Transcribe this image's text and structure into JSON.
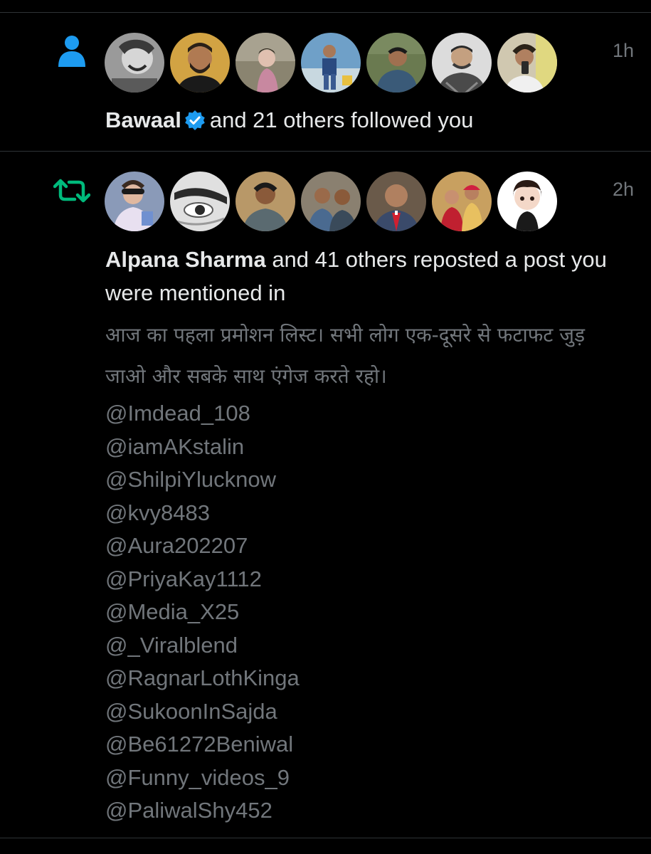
{
  "notifications": [
    {
      "type": "follow",
      "icon": "person-icon",
      "time": "1h",
      "lead_name": "Bawaal",
      "verified": true,
      "rest_text": "and 21 others followed you",
      "avatar_colors": [
        "#8a8a8a",
        "#c69a3c",
        "#9a8f7a",
        "#4a7ab0",
        "#5b6a4a",
        "#d8d8d8",
        "#c8c0a8"
      ]
    },
    {
      "type": "repost",
      "icon": "repost-icon",
      "time": "2h",
      "lead_name": "Alpana Sharma",
      "rest_text": " and 41 others reposted a post you were mentioned in",
      "post_text": "आज का पहला प्रमोशन लिस्ट। सभी लोग एक-दूसरे से फटाफट जुड़ जाओ और सबके साथ एंगेज करते रहो।",
      "mentions": [
        "@Imdead_108",
        "@iamAKstalin",
        "@ShilpiYlucknow",
        "@kvy8483",
        "@Aura202207",
        "@PriyaKay1112",
        "@Media_X25",
        "@_Viralblend",
        "@RagnarLothKinga",
        "@SukoonInSajda",
        "@Be61272Beniwal",
        "@Funny_videos_9",
        "@PaliwalShy452"
      ],
      "avatar_colors": [
        "#7a8aa8",
        "#b0b0b0",
        "#8a6a4a",
        "#6a7a8a",
        "#7a5a4a",
        "#c03a4a",
        "#e8e8e8"
      ]
    }
  ],
  "colors": {
    "background": "#000000",
    "divider": "#2f3336",
    "primary_text": "#e7e9ea",
    "secondary_text": "#71767b",
    "follow_icon": "#1d9bf0",
    "repost_icon": "#00ba7c",
    "verified_badge": "#1d9bf0"
  }
}
